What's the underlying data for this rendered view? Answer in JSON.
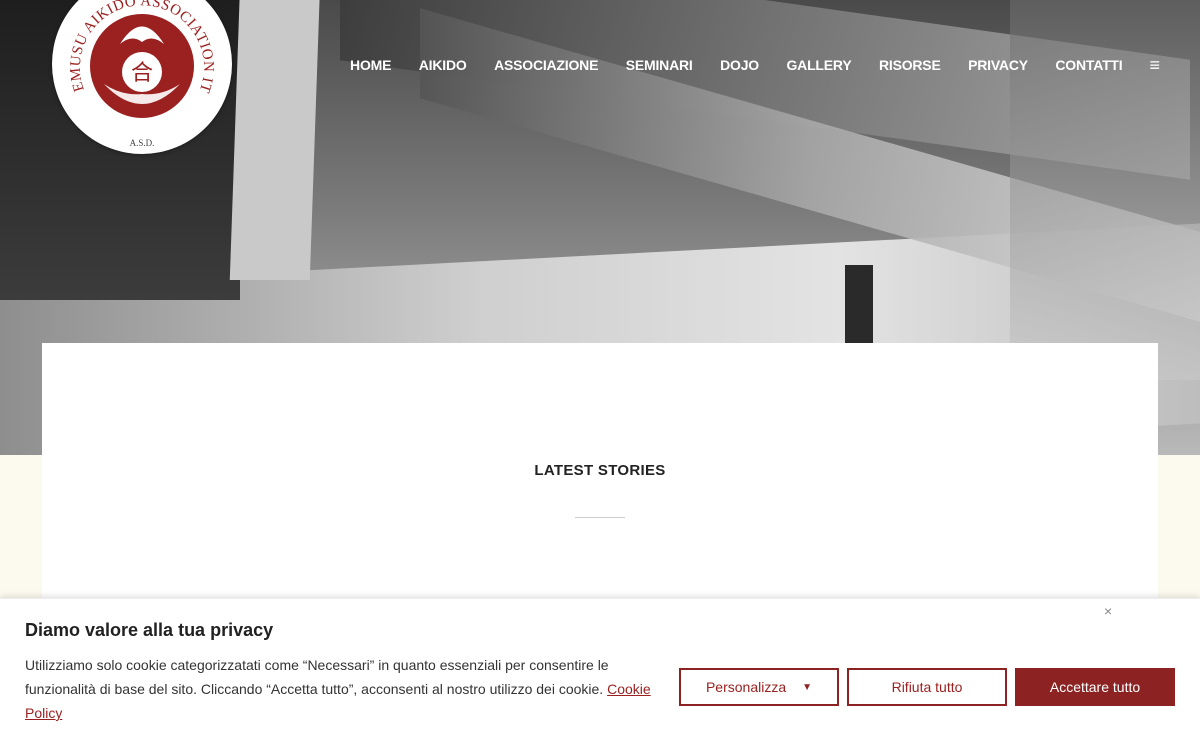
{
  "logo": {
    "circle_text": "TAKEMUSU AIKIDO ASSOCIATION ITALY",
    "kanji": "合",
    "subtitle": "A.S.D.",
    "brand_color": "#9b2121"
  },
  "nav": {
    "items": [
      "HOME",
      "AIKIDO",
      "ASSOCIAZIONE",
      "SEMINARI",
      "DOJO",
      "GALLERY",
      "RISORSE",
      "PRIVACY",
      "CONTATTI"
    ],
    "menu_icon": "≡"
  },
  "main": {
    "section_title": "LATEST STORIES"
  },
  "cookie": {
    "heading": "Diamo valore alla tua privacy",
    "description": "Utilizziamo solo cookie categorizzatati come “Necessari” in quanto essenziali per consentire le funzionalità di base del sito. Cliccando “Accetta tutto”, acconsenti al nostro utilizzo dei cookie.",
    "policy_link": "Cookie Policy",
    "close_icon": "×",
    "customize_label": "Personalizza",
    "reject_label": "Rifiuta tutto",
    "accept_label": "Accettare tutto",
    "accent_color": "#8d2222"
  }
}
